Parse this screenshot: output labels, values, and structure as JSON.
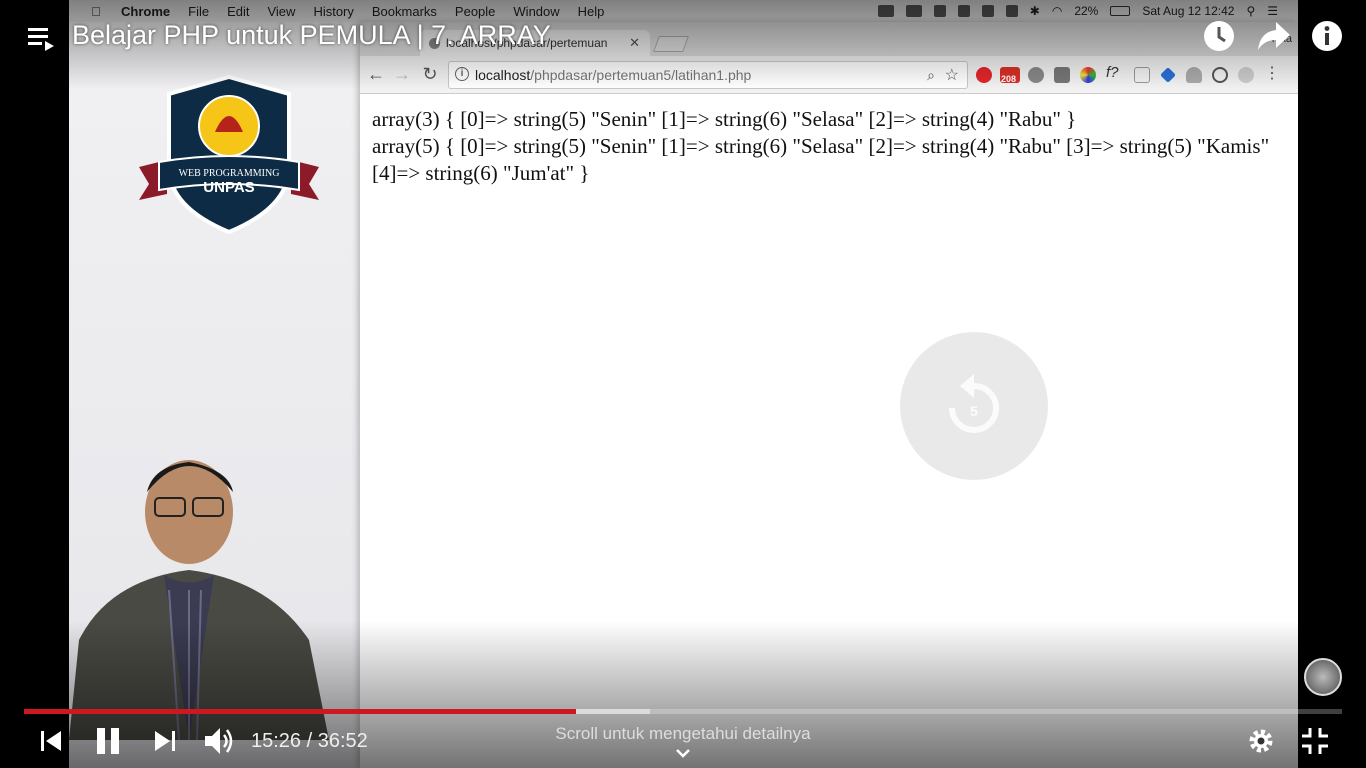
{
  "player": {
    "video_title": "Belajar PHP untuk PEMULA | 7. ARRAY",
    "current_time": "15:26",
    "duration": "36:52",
    "time_display": "15:26 / 36:52",
    "progress_fraction": 0.4186,
    "buffered_fraction": 0.475,
    "scroll_hint": "Scroll untuk mengetahui detailnya",
    "accent_color": "#cc181e",
    "icons": [
      "playlist-icon",
      "watch-later-icon",
      "share-icon",
      "info-icon",
      "previous-icon",
      "pause-icon",
      "next-icon",
      "volume-icon",
      "settings-icon",
      "exit-fullscreen-icon",
      "chevron-down-icon"
    ]
  },
  "mac": {
    "menu": [
      "Chrome",
      "File",
      "Edit",
      "View",
      "History",
      "Bookmarks",
      "People",
      "Window",
      "Help"
    ],
    "battery": "22%",
    "clock": "Sat Aug 12  12:42"
  },
  "browser": {
    "tab_title": "localhost/phpdasar/pertemuan",
    "url_host": "localhost",
    "url_path": "/phpdasar/pertemuan5/latihan1.php",
    "profile_name": "hika",
    "mail_badge": "208"
  },
  "page": {
    "line1": "array(3) { [0]=> string(5) \"Senin\" [1]=> string(6) \"Selasa\" [2]=> string(4) \"Rabu\" }",
    "line2": "array(5) { [0]=> string(5) \"Senin\" [1]=> string(6) \"Selasa\" [2]=> string(4) \"Rabu\" [3]=> string(5) \"Kamis\" [4]=> string(6) \"Jum'at\" }"
  },
  "logo": {
    "line1": "WEB PROGRAMMING",
    "line2": "UNPAS"
  },
  "replay_overlay": {
    "seconds": "5"
  }
}
